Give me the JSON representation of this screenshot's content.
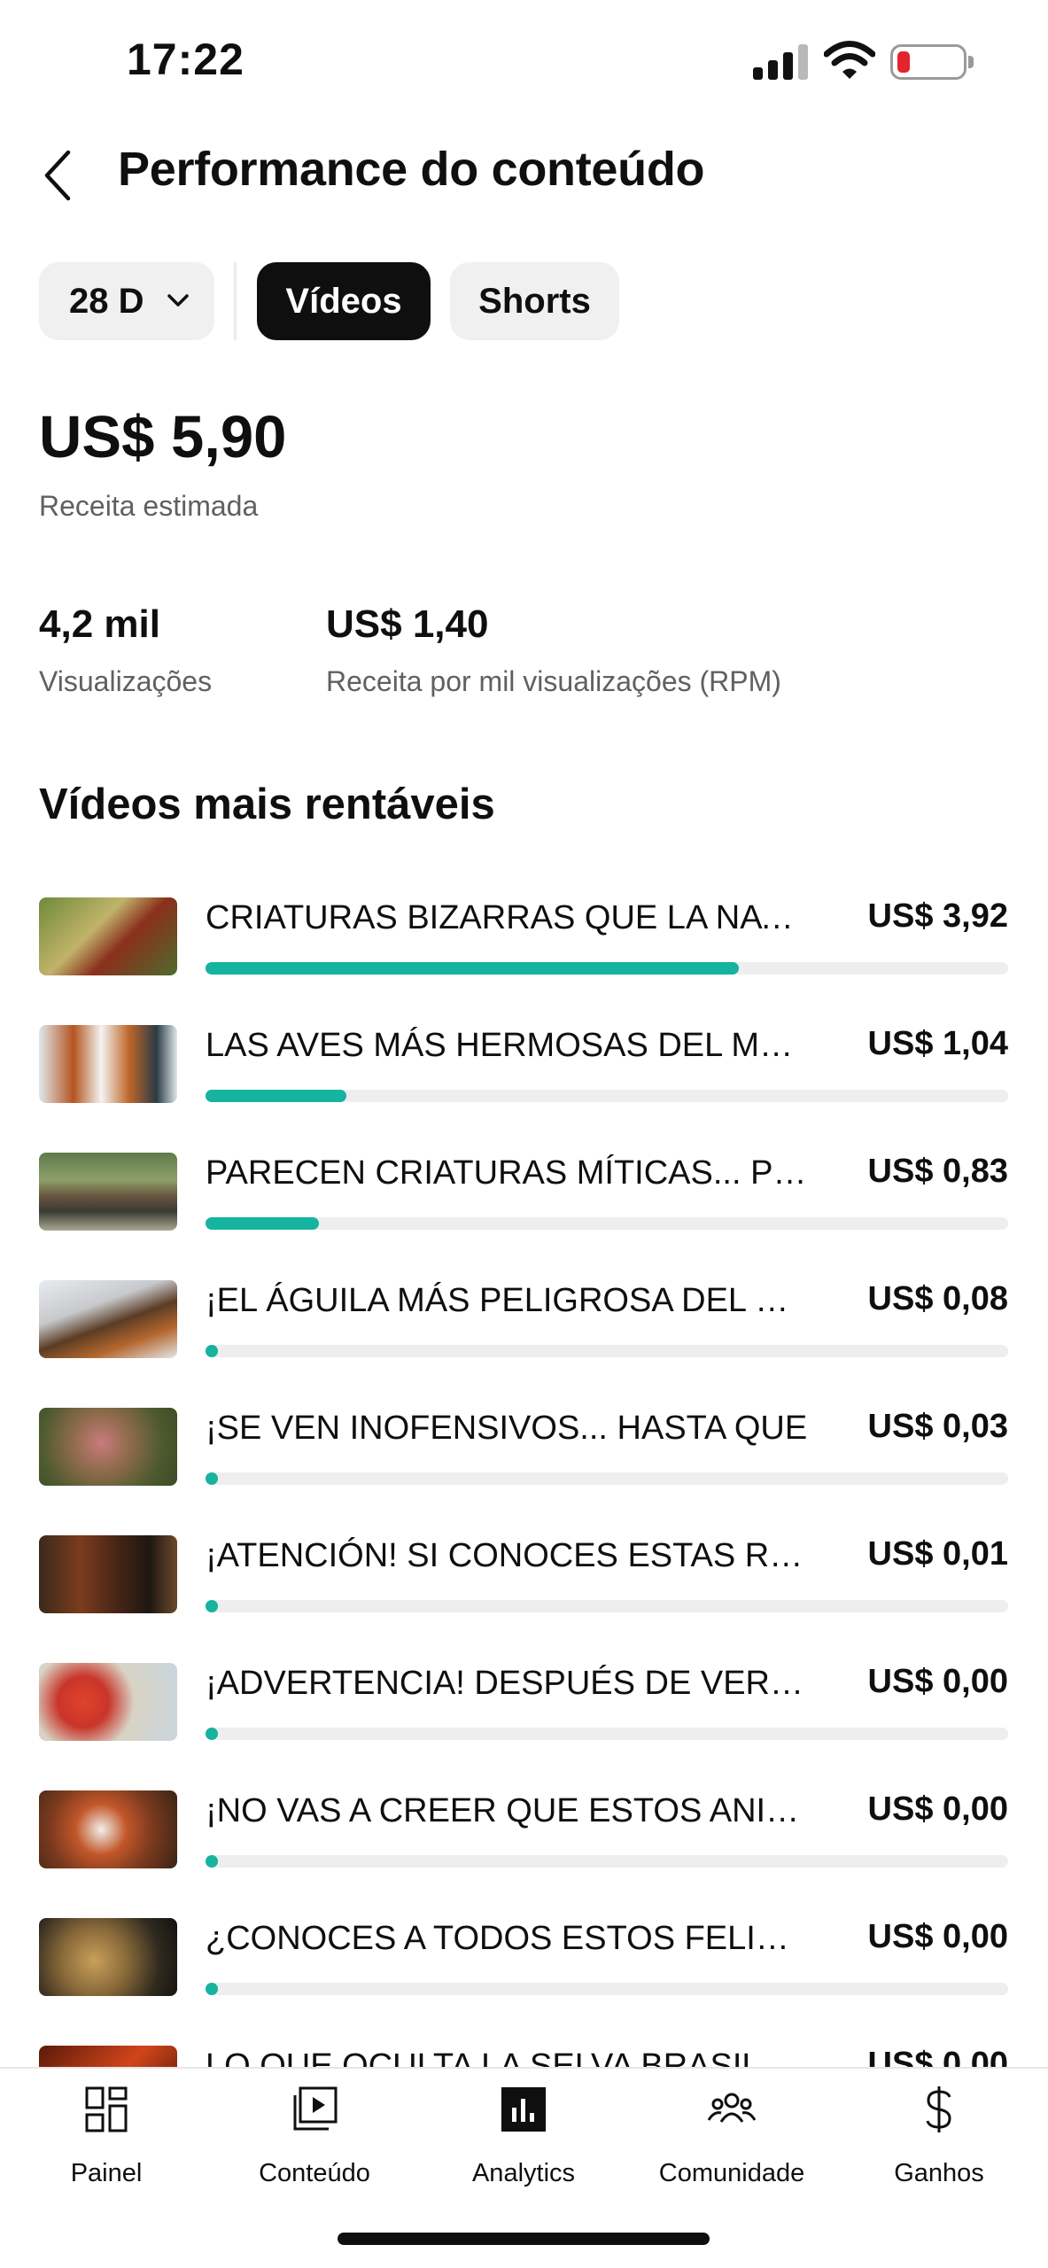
{
  "status_bar": {
    "time": "17:22"
  },
  "header": {
    "title": "Performance do conteúdo"
  },
  "filters": {
    "period": "28 D",
    "tabs": [
      {
        "label": "Vídeos",
        "selected": true
      },
      {
        "label": "Shorts",
        "selected": false
      }
    ]
  },
  "summary": {
    "revenue_value": "US$ 5,90",
    "revenue_label": "Receita estimada",
    "views_value": "4,2 mil",
    "views_label": "Visualizações",
    "rpm_value": "US$ 1,40",
    "rpm_label": "Receita por mil visualizações (RPM)"
  },
  "section_title": "Vídeos mais rentáveis",
  "videos": [
    {
      "title": "CRIATURAS BIZARRAS QUE LA NATURALEZA",
      "revenue": "US$ 3,92",
      "share": 0.665,
      "thumb": "bird-icon"
    },
    {
      "title": "LAS AVES MÁS HERMOSAS DEL MUNDO",
      "revenue": "US$ 1,04",
      "share": 0.176,
      "thumb": "ducks-icon"
    },
    {
      "title": "PARECEN CRIATURAS MÍTICAS... PERO SON REALES",
      "revenue": "US$ 0,83",
      "share": 0.141,
      "thumb": "horse-icon"
    },
    {
      "title": "¡EL ÁGUILA MÁS PELIGROSA DEL MUNDO",
      "revenue": "US$ 0,08",
      "share": 0.014,
      "thumb": "eagle-icon"
    },
    {
      "title": "¡SE VEN INOFENSIVOS... HASTA QUE",
      "revenue": "US$ 0,03",
      "share": 0.005,
      "thumb": "octopus-icon"
    },
    {
      "title": "¡ATENCIÓN! SI CONOCES ESTAS RAZAS",
      "revenue": "US$ 0,01",
      "share": 0.002,
      "thumb": "cattle-icon"
    },
    {
      "title": "¡ADVERTENCIA! DESPUÉS DE VER ESTO",
      "revenue": "US$ 0,00",
      "share": 0,
      "thumb": "monkey-icon"
    },
    {
      "title": "¡NO VAS A CREER QUE ESTOS ANIMALES",
      "revenue": "US$ 0,00",
      "share": 0,
      "thumb": "red-panda-icon"
    },
    {
      "title": "¿CONOCES A TODOS ESTOS FELINOS",
      "revenue": "US$ 0,00",
      "share": 0,
      "thumb": "serval-icon"
    },
    {
      "title": "LO QUE OCULTA LA SELVA BRASILEÑA",
      "revenue": "US$ 0,00",
      "share": 0,
      "thumb": "jungle-icon"
    }
  ],
  "bottom_nav": [
    {
      "label": "Painel",
      "icon": "dashboard-icon"
    },
    {
      "label": "Conteúdo",
      "icon": "content-icon"
    },
    {
      "label": "Analytics",
      "icon": "analytics-icon",
      "selected": true
    },
    {
      "label": "Comunidade",
      "icon": "community-icon"
    },
    {
      "label": "Ganhos",
      "icon": "dollar-icon"
    }
  ],
  "colors": {
    "accent": "#15b3a0",
    "text": "#0f0f0f",
    "secondary": "#606060",
    "chip": "#f0f0f0",
    "track": "#eeeeee"
  }
}
